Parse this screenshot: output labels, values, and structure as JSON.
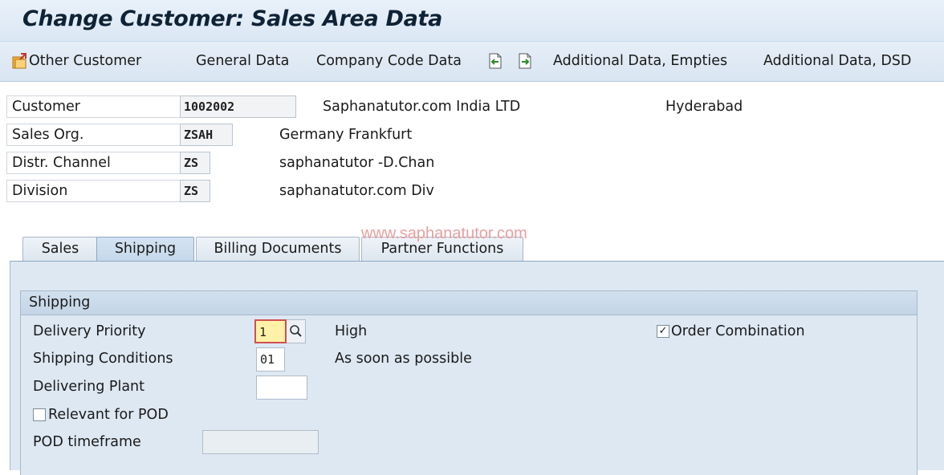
{
  "title": "Change Customer: Sales Area Data",
  "toolbar": {
    "other_customer": "Other Customer",
    "general_data": "General Data",
    "company_code_data": "Company Code Data",
    "additional_data_empties": "Additional Data, Empties",
    "additional_data_dsd": "Additional Data, DSD"
  },
  "header": {
    "customer_label": "Customer",
    "customer_value": "1002002",
    "customer_name": "Saphanatutor.com  India LTD",
    "customer_city": "Hyderabad",
    "sales_org_label": "Sales Org.",
    "sales_org_value": "ZSAH",
    "sales_org_text": "Germany Frankfurt",
    "distr_channel_label": "Distr. Channel",
    "distr_channel_value": "ZS",
    "distr_channel_text": "saphanatutor -D.Chan",
    "division_label": "Division",
    "division_value": "ZS",
    "division_text": "saphanatutor.com Div"
  },
  "watermark": "www.saphanatutor.com",
  "tabs": [
    {
      "label": "Sales"
    },
    {
      "label": "Shipping"
    },
    {
      "label": "Billing Documents"
    },
    {
      "label": "Partner Functions"
    }
  ],
  "active_tab": "Shipping",
  "shipping": {
    "group_title": "Shipping",
    "delivery_priority_label": "Delivery Priority",
    "delivery_priority_value": "1",
    "delivery_priority_text": "High",
    "order_combination_label": "Order Combination",
    "order_combination_checked": true,
    "shipping_conditions_label": "Shipping Conditions",
    "shipping_conditions_value": "01",
    "shipping_conditions_text": "As soon as possible",
    "delivering_plant_label": "Delivering Plant",
    "delivering_plant_value": "",
    "relevant_pod_label": "Relevant for POD",
    "relevant_pod_checked": false,
    "pod_timeframe_label": "POD timeframe",
    "pod_timeframe_value": ""
  },
  "colors": {
    "title_bar": "#dbe7f4",
    "panel_bg": "#dde8f3",
    "focus_field": "#fff2a8",
    "watermark": "#e8a0a0"
  }
}
